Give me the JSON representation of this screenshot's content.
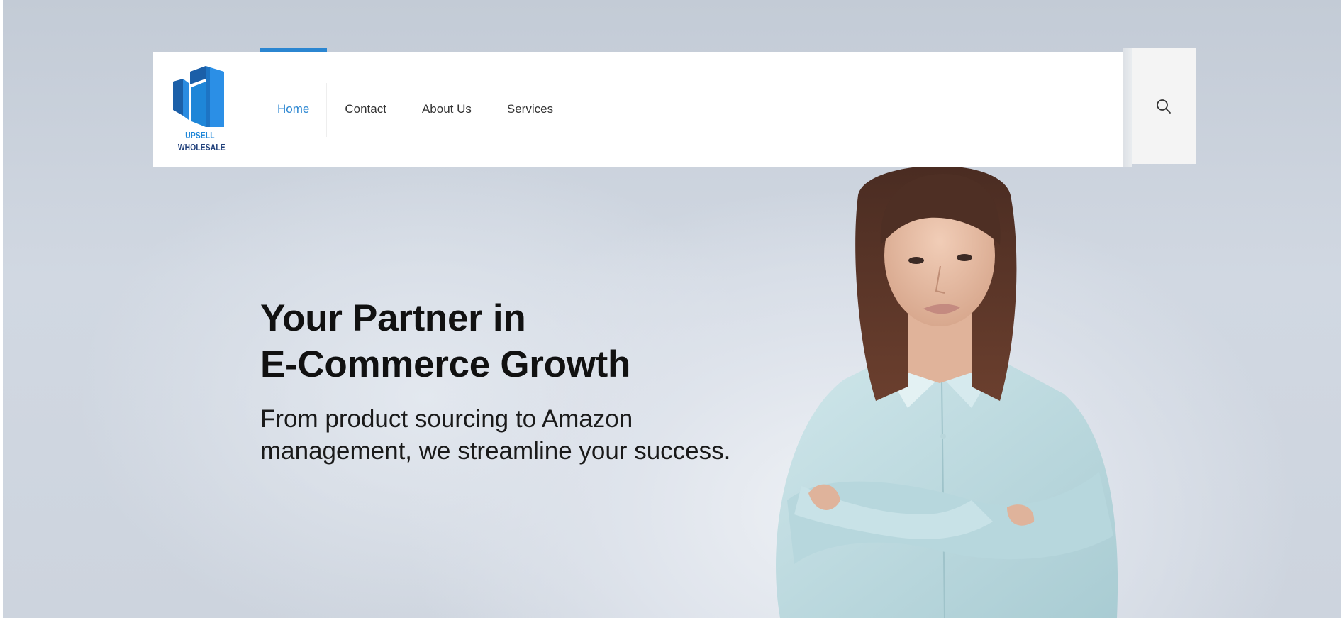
{
  "brand": {
    "name_line1": "UPSELL",
    "name_line2": "WHOLESALE",
    "logo_icon": "buildings-logo",
    "accent_color": "#2b86d1",
    "dark_color": "#1f3f7a"
  },
  "nav": {
    "items": [
      {
        "label": "Home",
        "active": true
      },
      {
        "label": "Contact",
        "active": false
      },
      {
        "label": "About Us",
        "active": false
      },
      {
        "label": "Services",
        "active": false
      }
    ],
    "search_icon": "search-icon"
  },
  "hero": {
    "title_line1": "Your Partner in",
    "title_line2": "E-Commerce Growth",
    "subtitle_line1": "From product sourcing to Amazon",
    "subtitle_line2": "management, we streamline your success."
  }
}
